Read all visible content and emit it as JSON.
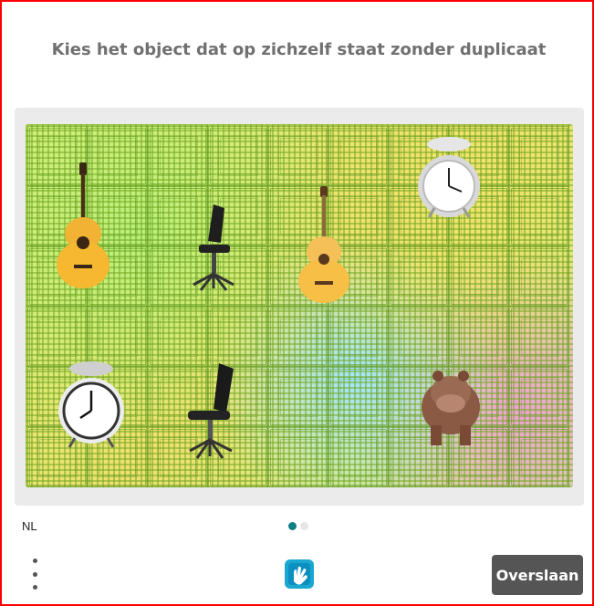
{
  "challenge": {
    "prompt": "Kies het object dat op zichzelf staat zonder duplicaat",
    "objects": [
      "guitar-icon",
      "office-chair-icon",
      "guitar-icon",
      "alarm-clock-icon",
      "alarm-clock-icon",
      "office-chair-icon",
      "hippopotamus-icon"
    ]
  },
  "footer": {
    "language": "NL",
    "pages": 2,
    "current_page": 1,
    "skip_label": "Overslaan"
  },
  "colors": {
    "frame_border": "#ff0000",
    "accent": "#0f7f85",
    "skip_button_bg": "#555555",
    "prompt_text": "#707070"
  }
}
